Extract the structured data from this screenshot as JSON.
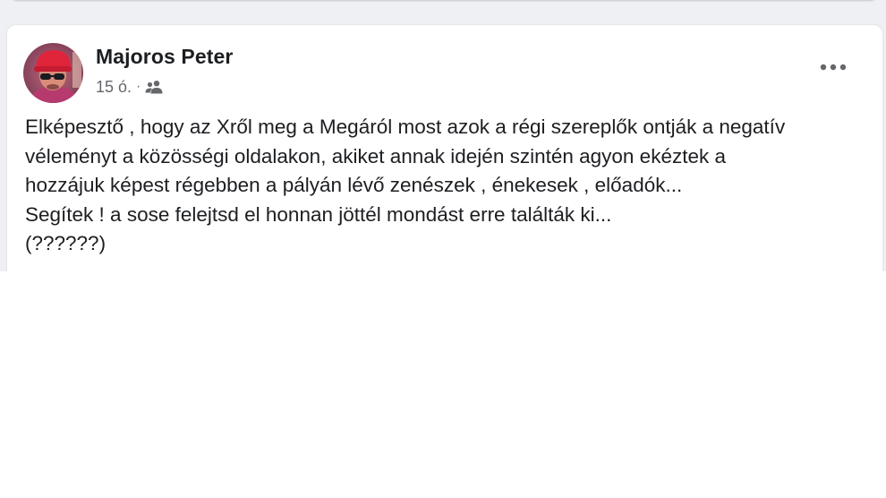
{
  "post": {
    "author": "Majoros Peter",
    "time": "15 ó.",
    "separator": "·",
    "audience_icon": "friends-icon",
    "more_icon": "more-dots-icon",
    "lines": [
      "Elképesztő , hogy az Xről meg a Megáról most azok a régi szereplők ontják a negatív",
      "véleményt a közösségi oldalakon, akiket annak idején szintén agyon ekéztek a",
      "hozzájuk képest régebben a pályán lévő zenészek , énekesek , előadók...",
      "Segítek ! a sose felejtsd el honnan jöttél mondást erre találták ki...",
      "(??????)"
    ]
  },
  "colors": {
    "feed_background": "#eef0f3",
    "card_background": "#ffffff",
    "text_primary": "#1c1e21",
    "text_secondary": "#65676b"
  }
}
